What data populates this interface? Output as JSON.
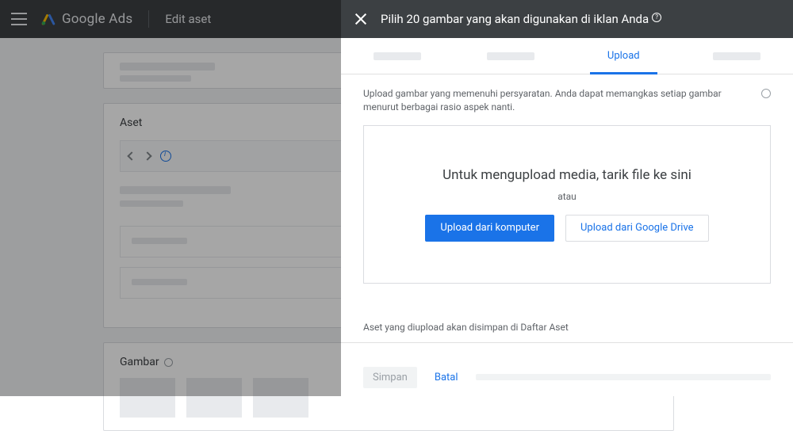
{
  "header": {
    "brand": "Google Ads",
    "page_title": "Edit aset"
  },
  "background": {
    "section_aset": "Aset",
    "section_gambar": "Gambar"
  },
  "modal": {
    "title": "Pilih 20 gambar yang akan digunakan di iklan Anda",
    "help_glyph": "?",
    "tabs": {
      "active_label": "Upload"
    },
    "hint": "Upload gambar yang memenuhi persyaratan. Anda dapat memangkas setiap gambar menurut berbagai rasio aspek nanti.",
    "dropzone": {
      "main": "Untuk mengupload media, tarik file ke sini",
      "or": "atau",
      "btn_computer": "Upload dari komputer",
      "btn_drive": "Upload dari Google Drive"
    },
    "note": "Aset yang diupload akan disimpan di Daftar Aset",
    "footer": {
      "save": "Simpan",
      "cancel": "Batal"
    }
  }
}
